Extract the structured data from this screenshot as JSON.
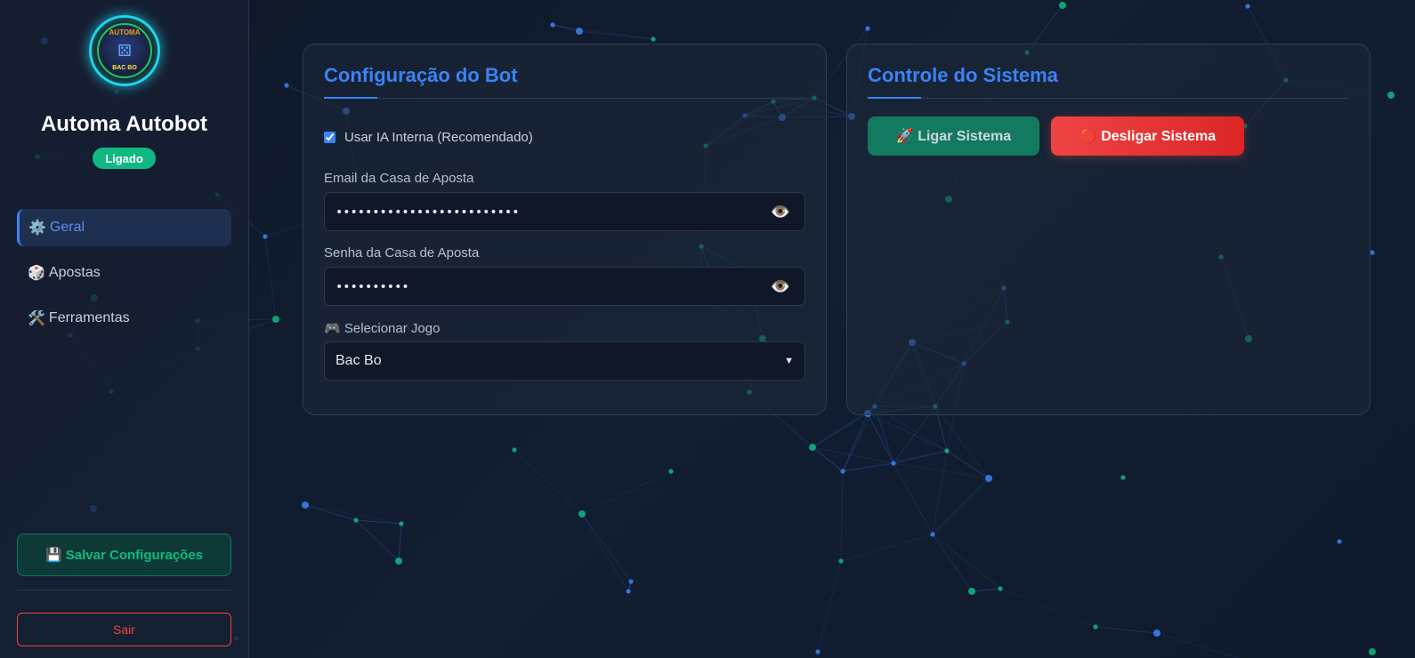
{
  "sidebar": {
    "app_title": "Automa Autobot",
    "logo": {
      "top_text": "AUTOMA",
      "bottom_text": "BAC BO",
      "icon": "dice-icon"
    },
    "status": "Ligado",
    "nav": [
      {
        "icon": "⚙️",
        "label": "Geral",
        "active": true
      },
      {
        "icon": "🎲",
        "label": "Apostas",
        "active": false
      },
      {
        "icon": "🛠️",
        "label": "Ferramentas",
        "active": false
      }
    ],
    "save_button": "💾 Salvar Configurações",
    "logout_button": "Sair"
  },
  "config_card": {
    "title": "Configuração do Bot",
    "use_ai_label": "Usar IA Interna (Recomendado)",
    "use_ai_checked": true,
    "email_label": "Email da Casa de Aposta",
    "email_value": "•••••••••••••••••••••••••",
    "password_label": "Senha da Casa de Aposta",
    "password_value": "••••••••••",
    "game_label": "🎮 Selecionar Jogo",
    "game_selected": "Bac Bo",
    "eye_icon": "👁️"
  },
  "control_card": {
    "title": "Controle do Sistema",
    "start_button": "🚀 Ligar Sistema",
    "stop_button": "🔴 Desligar Sistema"
  },
  "colors": {
    "accent": "#3b82f6",
    "success": "#10b981",
    "danger": "#ef4444",
    "node_blue": "#3b82f6",
    "node_green": "#10b981"
  }
}
